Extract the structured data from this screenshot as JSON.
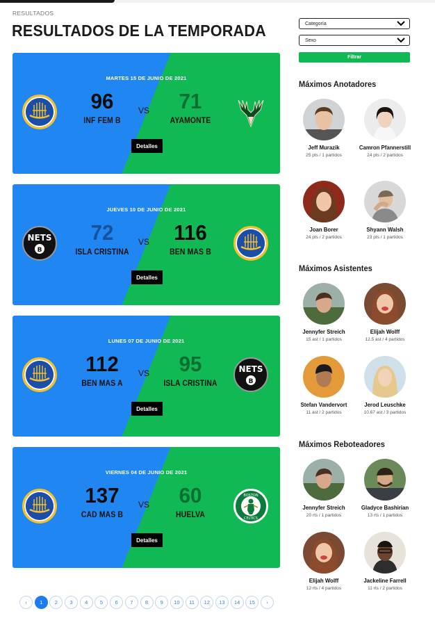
{
  "breadcrumb": "RESULTADOS",
  "page_title": "RESULTADOS DE LA TEMPORADA",
  "games": [
    {
      "date": "MARTES 15 DE JUNIO DE 2021",
      "home_score": "96",
      "away_score": "71",
      "home_name": "INF FEM B",
      "away_name": "AYAMONTE",
      "vs": "VS",
      "details": "Detalles",
      "home_logo": "warriors-logo-icon",
      "away_logo": "bucks-logo-icon"
    },
    {
      "date": "JUEVES 10 DE JUNIO DE 2021",
      "home_score": "72",
      "away_score": "116",
      "home_name": "ISLA CRISTINA",
      "away_name": "BEN MAS B",
      "vs": "VS",
      "details": "Detalles",
      "home_logo": "nets-logo-icon",
      "away_logo": "warriors-logo-icon"
    },
    {
      "date": "LUNES 07 DE JUNIO DE 2021",
      "home_score": "112",
      "away_score": "95",
      "home_name": "BEN MAS A",
      "away_name": "ISLA CRISTINA",
      "vs": "VS",
      "details": "Detalles",
      "home_logo": "warriors-logo-icon",
      "away_logo": "nets-logo-icon"
    },
    {
      "date": "VIERNES 04 DE JUNIO DE 2021",
      "home_score": "137",
      "away_score": "60",
      "home_name": "CAD MAS B",
      "away_name": "HUELVA",
      "vs": "VS",
      "details": "Detalles",
      "home_logo": "warriors-logo-icon",
      "away_logo": "celtics-logo-icon"
    }
  ],
  "pagination": {
    "prev": "‹",
    "next": "›",
    "pages": [
      "1",
      "2",
      "3",
      "4",
      "5",
      "6",
      "7",
      "8",
      "9",
      "10",
      "11",
      "12",
      "13",
      "14",
      "15"
    ],
    "current": "1"
  },
  "filters": {
    "category": "Categoría",
    "sex": "Sexo",
    "button": "Filtrar"
  },
  "top_scorers": {
    "title": "Máximos Anotadores",
    "players": [
      {
        "name": "Jeff Murazik",
        "stat": "25 pts / 1 partidos"
      },
      {
        "name": "Camron Pfannerstill",
        "stat": "24 pts / 2 partidos"
      },
      {
        "name": "Joan Borer",
        "stat": "24 pts / 2 partidos"
      },
      {
        "name": "Shyann Walsh",
        "stat": "23 pts / 1 partidos"
      }
    ]
  },
  "top_assists": {
    "title": "Máximos Asistentes",
    "players": [
      {
        "name": "Jennyfer Streich",
        "stat": "15 ast / 1 partidos"
      },
      {
        "name": "Elijah Wolff",
        "stat": "12.5 ast / 4 partidos"
      },
      {
        "name": "Stefan Vandervort",
        "stat": "11 ast / 2 partidos"
      },
      {
        "name": "Jerod Leuschke",
        "stat": "10.67 ast / 3 partidos"
      }
    ]
  },
  "top_rebounders": {
    "title": "Máximos Reboteadores",
    "players": [
      {
        "name": "Jennyfer Streich",
        "stat": "20 rts / 1 partidos"
      },
      {
        "name": "Gladyce Bashirian",
        "stat": "13 rts / 1 partidos"
      },
      {
        "name": "Elijah Wolff",
        "stat": "12 rts / 4 partidos"
      },
      {
        "name": "Jackeline Farrell",
        "stat": "11 rts / 2 partidos"
      }
    ]
  },
  "colors": {
    "blue": "#1f86f2",
    "green": "#11b955",
    "pagination_active": "#1c7cf0"
  }
}
